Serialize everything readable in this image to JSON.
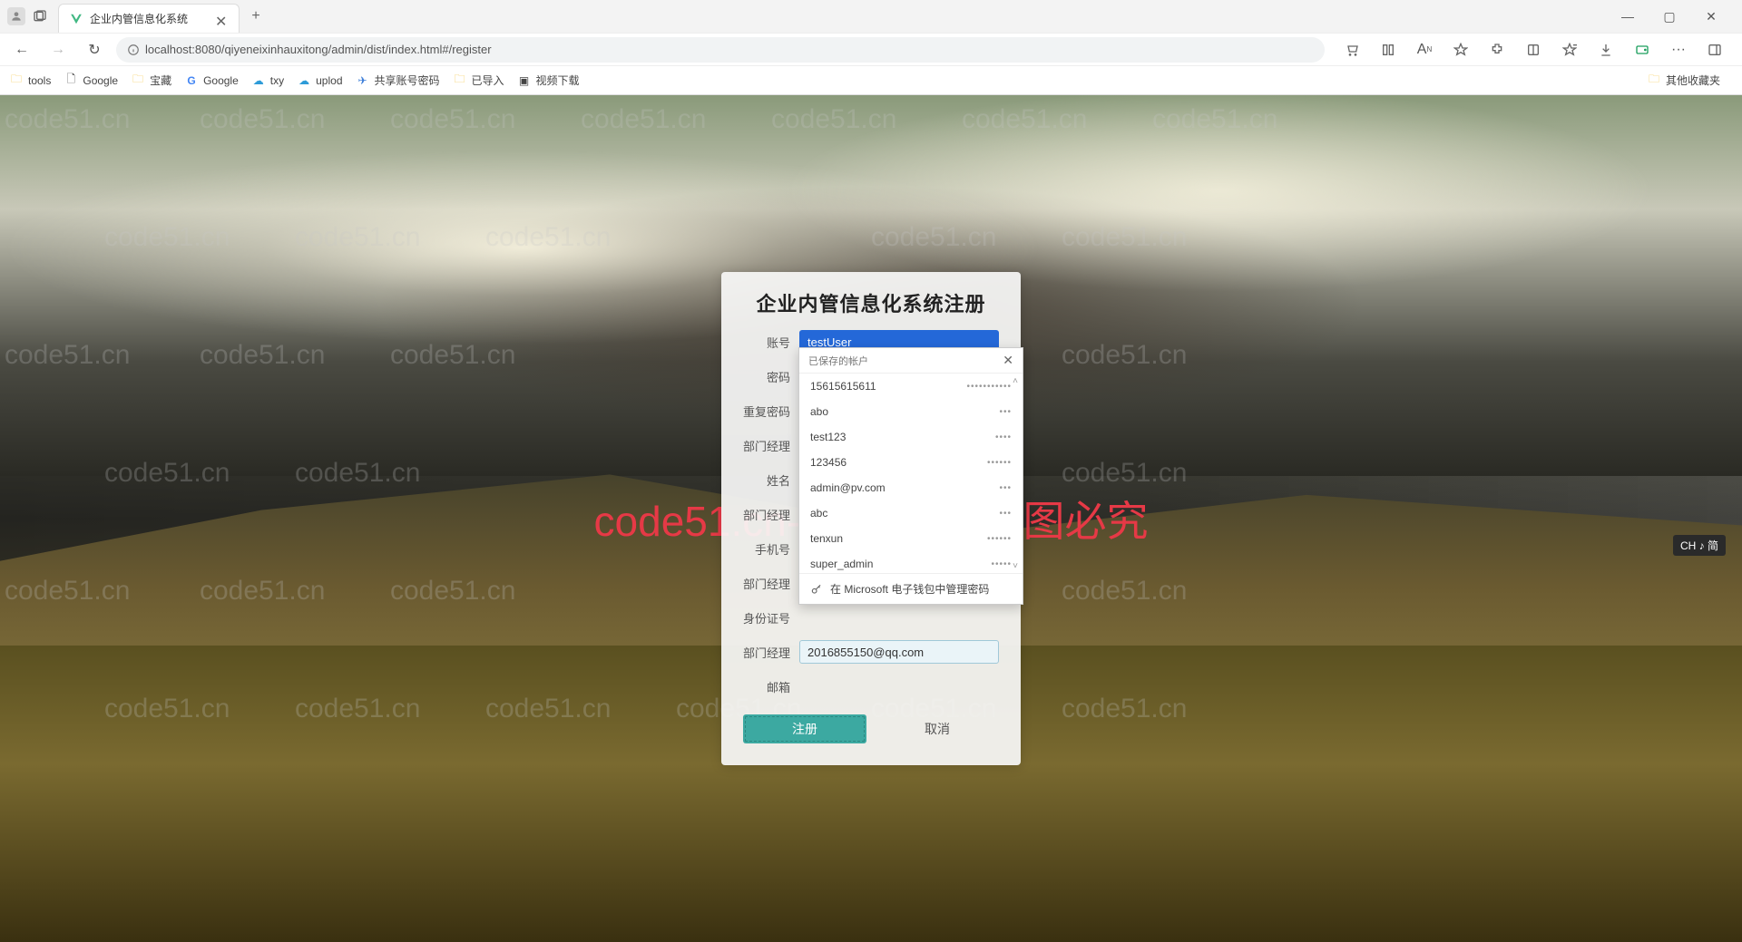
{
  "browser": {
    "tab_title": "企业内管信息化系统",
    "url": "localhost:8080/qiyeneixinhauxitong/admin/dist/index.html#/register",
    "win_min": "—",
    "win_max": "▢",
    "win_close": "✕",
    "new_tab": "+",
    "tab_close": "✕",
    "nav_back": "←",
    "nav_fwd": "→",
    "nav_reload": "↻"
  },
  "bookmarks": {
    "items": [
      {
        "label": "tools",
        "icon": "folder"
      },
      {
        "label": "Google",
        "icon": "page"
      },
      {
        "label": "宝藏",
        "icon": "folder"
      },
      {
        "label": "Google",
        "icon": "google"
      },
      {
        "label": "txy",
        "icon": "cloud"
      },
      {
        "label": "uplod",
        "icon": "cloud"
      },
      {
        "label": "共享账号密码",
        "icon": "fly"
      },
      {
        "label": "已导入",
        "icon": "folder"
      },
      {
        "label": "视频下载",
        "icon": "play"
      }
    ],
    "other": "其他收藏夹"
  },
  "watermark": {
    "text": "code51.cn",
    "big": "code51.cn--源码乐园盗图必究"
  },
  "form": {
    "title": "企业内管信息化系统注册",
    "labels": {
      "account": "账号",
      "password": "密码",
      "repeat": "重复密码",
      "manager1": "部门经理",
      "name": "姓名",
      "manager2": "部门经理",
      "phone": "手机号",
      "manager3": "部门经理",
      "idcard": "身份证号",
      "manager4": "部门经理",
      "email": "邮箱"
    },
    "values": {
      "account": "testUser",
      "manager4": "2016855150@qq.com"
    },
    "buttons": {
      "register": "注册",
      "cancel": "取消"
    }
  },
  "autofill": {
    "header": "已保存的帐户",
    "close": "✕",
    "items": [
      {
        "user": "15615615611",
        "pwd": "•••••••••••"
      },
      {
        "user": "abo",
        "pwd": "•••"
      },
      {
        "user": "test123",
        "pwd": "••••"
      },
      {
        "user": "123456",
        "pwd": "••••••"
      },
      {
        "user": "admin@pv.com",
        "pwd": "•••"
      },
      {
        "user": "abc",
        "pwd": "•••"
      },
      {
        "user": "tenxun",
        "pwd": "••••••"
      },
      {
        "user": "super_admin",
        "pwd": "•••••"
      }
    ],
    "footer": "在 Microsoft 电子钱包中管理密码"
  },
  "ime": {
    "label": "CH ♪ 简"
  }
}
